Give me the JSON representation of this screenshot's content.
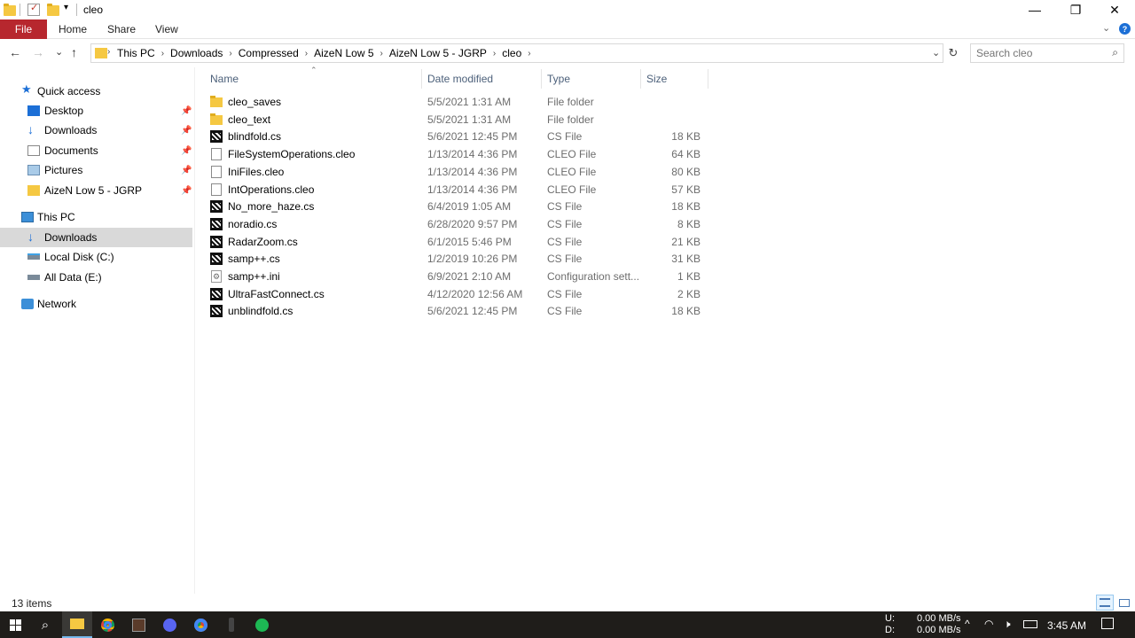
{
  "window": {
    "title": "cleo",
    "controls": {
      "minimize": "—",
      "maximize": "❐",
      "close": "✕"
    }
  },
  "ribbon": {
    "tabs": [
      "File",
      "Home",
      "Share",
      "View"
    ],
    "help": "?"
  },
  "navigation": {
    "back": "←",
    "forward": "→",
    "recent": "⌄",
    "up": "↑"
  },
  "address": {
    "crumbs": [
      "This PC",
      "Downloads",
      "Compressed",
      "AizeN Low 5",
      "AizeN Low 5 - JGRP",
      "cleo"
    ],
    "separator": "›",
    "dropdown": "⌄",
    "refresh": "↻"
  },
  "search": {
    "placeholder": "Search cleo",
    "value": ""
  },
  "sidebar": {
    "quick_access": "Quick access",
    "items": [
      {
        "label": "Desktop",
        "icon": "desktop-icon",
        "pinned": true
      },
      {
        "label": "Downloads",
        "icon": "download-arrow-icon",
        "pinned": true
      },
      {
        "label": "Documents",
        "icon": "documents-icon",
        "pinned": true
      },
      {
        "label": "Pictures",
        "icon": "pictures-icon",
        "pinned": true
      },
      {
        "label": "AizeN Low 5 - JGRP",
        "icon": "folder-icon",
        "pinned": true
      }
    ],
    "this_pc": "This PC",
    "pc_items": [
      {
        "label": "Downloads",
        "icon": "download-arrow-icon",
        "selected": true
      },
      {
        "label": "Local Disk (C:)",
        "icon": "drive-icon"
      },
      {
        "label": "All Data (E:)",
        "icon": "drive-icon"
      }
    ],
    "network": "Network"
  },
  "columns": {
    "name": "Name",
    "date": "Date modified",
    "type": "Type",
    "size": "Size"
  },
  "files": [
    {
      "name": "cleo_saves",
      "date": "5/5/2021 1:31 AM",
      "type": "File folder",
      "size": "",
      "icon": "folder"
    },
    {
      "name": "cleo_text",
      "date": "5/5/2021 1:31 AM",
      "type": "File folder",
      "size": "",
      "icon": "folder"
    },
    {
      "name": "blindfold.cs",
      "date": "5/6/2021 12:45 PM",
      "type": "CS File",
      "size": "18 KB",
      "icon": "cs"
    },
    {
      "name": "FileSystemOperations.cleo",
      "date": "1/13/2014 4:36 PM",
      "type": "CLEO File",
      "size": "64 KB",
      "icon": "doc"
    },
    {
      "name": "IniFiles.cleo",
      "date": "1/13/2014 4:36 PM",
      "type": "CLEO File",
      "size": "80 KB",
      "icon": "doc"
    },
    {
      "name": "IntOperations.cleo",
      "date": "1/13/2014 4:36 PM",
      "type": "CLEO File",
      "size": "57 KB",
      "icon": "doc"
    },
    {
      "name": "No_more_haze.cs",
      "date": "6/4/2019 1:05 AM",
      "type": "CS File",
      "size": "18 KB",
      "icon": "cs"
    },
    {
      "name": "noradio.cs",
      "date": "6/28/2020 9:57 PM",
      "type": "CS File",
      "size": "8 KB",
      "icon": "cs"
    },
    {
      "name": "RadarZoom.cs",
      "date": "6/1/2015 5:46 PM",
      "type": "CS File",
      "size": "21 KB",
      "icon": "cs"
    },
    {
      "name": "samp++.cs",
      "date": "1/2/2019 10:26 PM",
      "type": "CS File",
      "size": "31 KB",
      "icon": "cs"
    },
    {
      "name": "samp++.ini",
      "date": "6/9/2021 2:10 AM",
      "type": "Configuration sett...",
      "size": "1 KB",
      "icon": "ini"
    },
    {
      "name": "UltraFastConnect.cs",
      "date": "4/12/2020 12:56 AM",
      "type": "CS File",
      "size": "2 KB",
      "icon": "cs"
    },
    {
      "name": "unblindfold.cs",
      "date": "5/6/2021 12:45 PM",
      "type": "CS File",
      "size": "18 KB",
      "icon": "cs"
    }
  ],
  "status": {
    "item_count": "13 items"
  },
  "taskbar": {
    "apps": [
      "start-icon",
      "search-icon",
      "file-explorer-icon",
      "chrome-icon",
      "game-icon",
      "discord-icon",
      "chrome-icon",
      "app-icon",
      "spotify-icon"
    ],
    "net_labels": {
      "up": "U:",
      "down": "D:"
    },
    "net_up": "0.00 MB/s",
    "net_down": "0.00 MB/s",
    "time": "3:45 AM"
  },
  "colors": {
    "file_tab": "#b7272e",
    "selected_nav": "#d9d9d9",
    "taskbar": "#1f1d1a",
    "folder": "#f5c842",
    "column_header": "#4c607a"
  }
}
